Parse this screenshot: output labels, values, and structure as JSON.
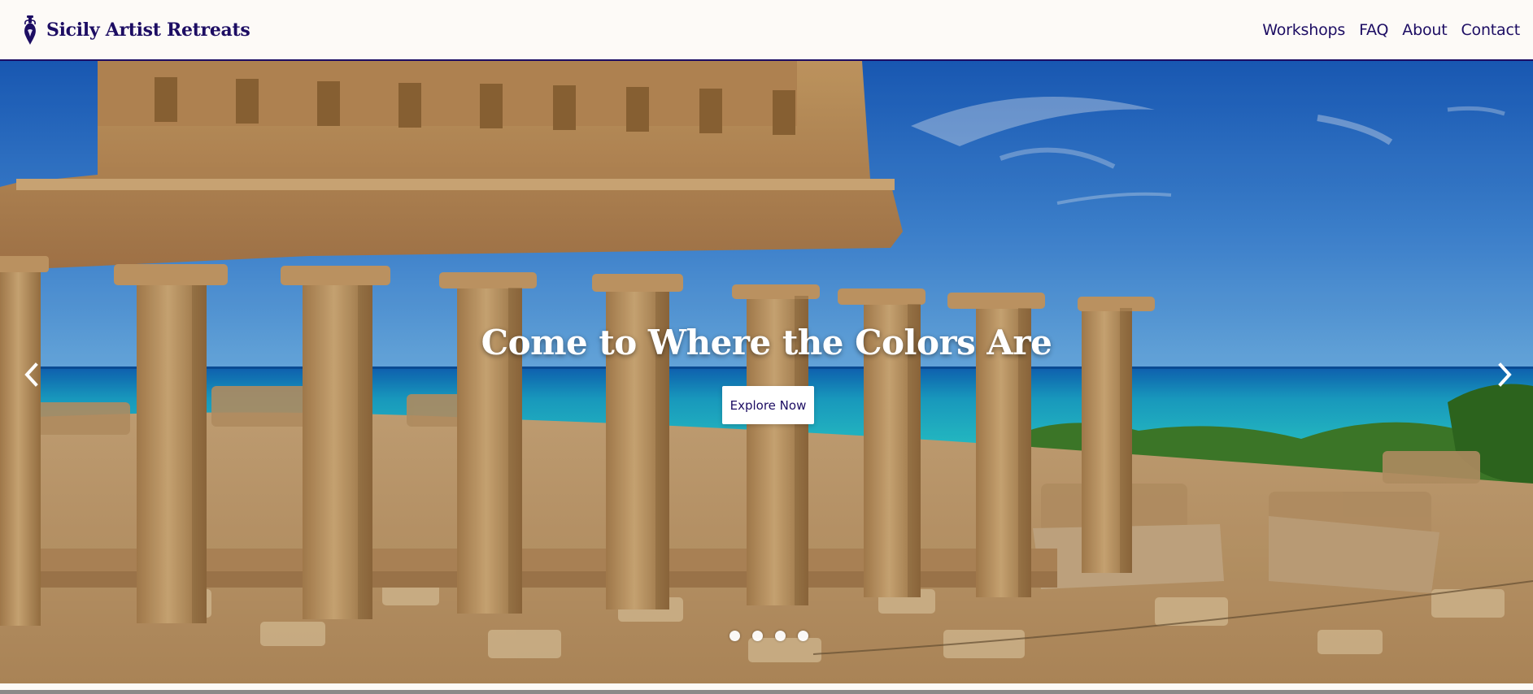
{
  "brand": {
    "name": "Sicily Artist Retreats",
    "logo_icon": "amphora-icon"
  },
  "nav": {
    "items": [
      {
        "label": "Workshops"
      },
      {
        "label": "FAQ"
      },
      {
        "label": "About"
      },
      {
        "label": "Contact"
      }
    ]
  },
  "hero": {
    "title": "Come to Where the Colors Are",
    "cta_label": "Explore Now",
    "prev_icon": "chevron-left-icon",
    "next_icon": "chevron-right-icon",
    "slide_count": 4
  },
  "colors": {
    "brand": "#1d0d63",
    "header_background": "#fdfaf7",
    "button_background": "#ffffff"
  }
}
